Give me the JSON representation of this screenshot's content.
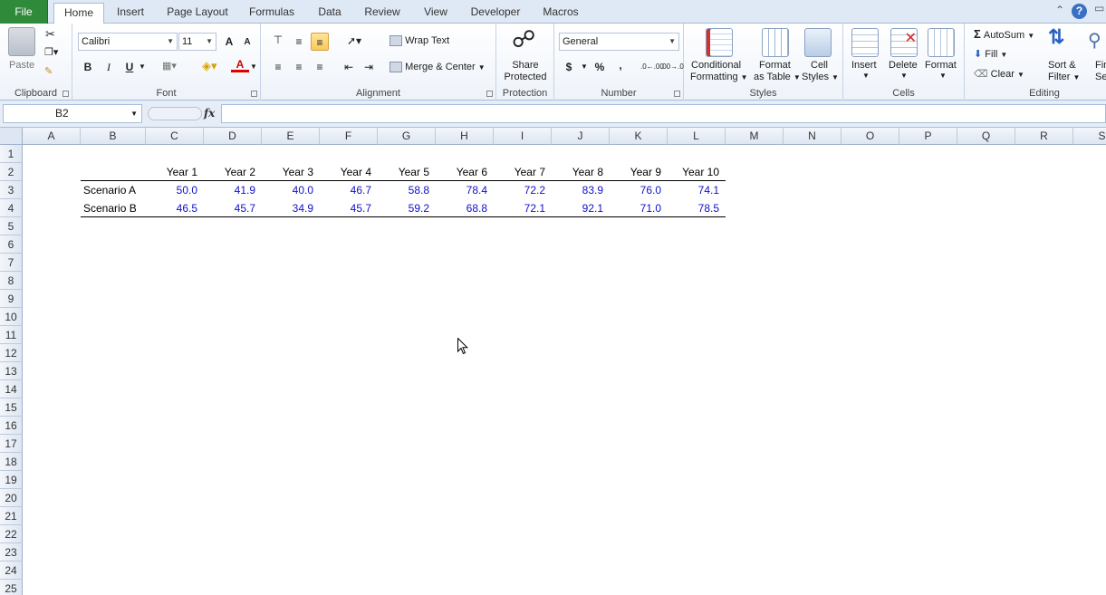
{
  "tabs": {
    "file": "File",
    "home": "Home",
    "insert": "Insert",
    "page_layout": "Page Layout",
    "formulas": "Formulas",
    "data": "Data",
    "review": "Review",
    "view": "View",
    "developer": "Developer",
    "macros": "Macros"
  },
  "clipboard": {
    "paste": "Paste",
    "label": "Clipboard"
  },
  "font": {
    "name": "Calibri",
    "size": "11",
    "bold": "B",
    "italic": "I",
    "underline": "U",
    "label": "Font",
    "grow": "A",
    "shrink": "A",
    "color_letter": "A"
  },
  "alignment": {
    "wrap": "Wrap Text",
    "merge": "Merge & Center",
    "label": "Alignment"
  },
  "protection": {
    "share1": "Share",
    "share2": "Protected",
    "label": "Protection"
  },
  "number": {
    "format": "General",
    "currency": "$",
    "percent": "%",
    "comma": ",",
    "inc_dec": ".0←.00",
    "dec_dec": ".00→.0",
    "label": "Number"
  },
  "styles": {
    "cf1": "Conditional",
    "cf2": "Formatting",
    "ft1": "Format",
    "ft2": "as Table",
    "cs1": "Cell",
    "cs2": "Styles",
    "label": "Styles"
  },
  "cells": {
    "insert": "Insert",
    "delete": "Delete",
    "format": "Format",
    "label": "Cells"
  },
  "editing": {
    "autosum": "AutoSum",
    "fill": "Fill",
    "clear": "Clear",
    "sort1": "Sort &",
    "sort2": "Filter",
    "find1": "Find",
    "find2": "Selec",
    "label": "Editing"
  },
  "formula_bar": {
    "name_box": "B2",
    "fx": "fx",
    "value": ""
  },
  "columns": [
    "A",
    "B",
    "C",
    "D",
    "E",
    "F",
    "G",
    "H",
    "I",
    "J",
    "K",
    "L",
    "M",
    "N",
    "O",
    "P",
    "Q",
    "R",
    "S"
  ],
  "rows": [
    "1",
    "2",
    "3",
    "4",
    "5",
    "6",
    "7",
    "8",
    "9",
    "10",
    "11",
    "12",
    "13",
    "14",
    "15",
    "16",
    "17",
    "18",
    "19",
    "20",
    "21",
    "22",
    "23",
    "24",
    "25"
  ],
  "table": {
    "headers": [
      "Year 1",
      "Year 2",
      "Year 3",
      "Year 4",
      "Year 5",
      "Year 6",
      "Year 7",
      "Year 8",
      "Year 9",
      "Year 10"
    ],
    "rows": [
      {
        "label": "Scenario A",
        "values": [
          "50.0",
          "41.9",
          "40.0",
          "46.7",
          "58.8",
          "78.4",
          "72.2",
          "83.9",
          "76.0",
          "74.1"
        ]
      },
      {
        "label": "Scenario B",
        "values": [
          "46.5",
          "45.7",
          "34.9",
          "45.7",
          "59.2",
          "68.8",
          "72.1",
          "92.1",
          "71.0",
          "78.5"
        ]
      }
    ]
  },
  "colors": {
    "value_text": "#1010c8",
    "file_tab": "#2f8a3a"
  }
}
